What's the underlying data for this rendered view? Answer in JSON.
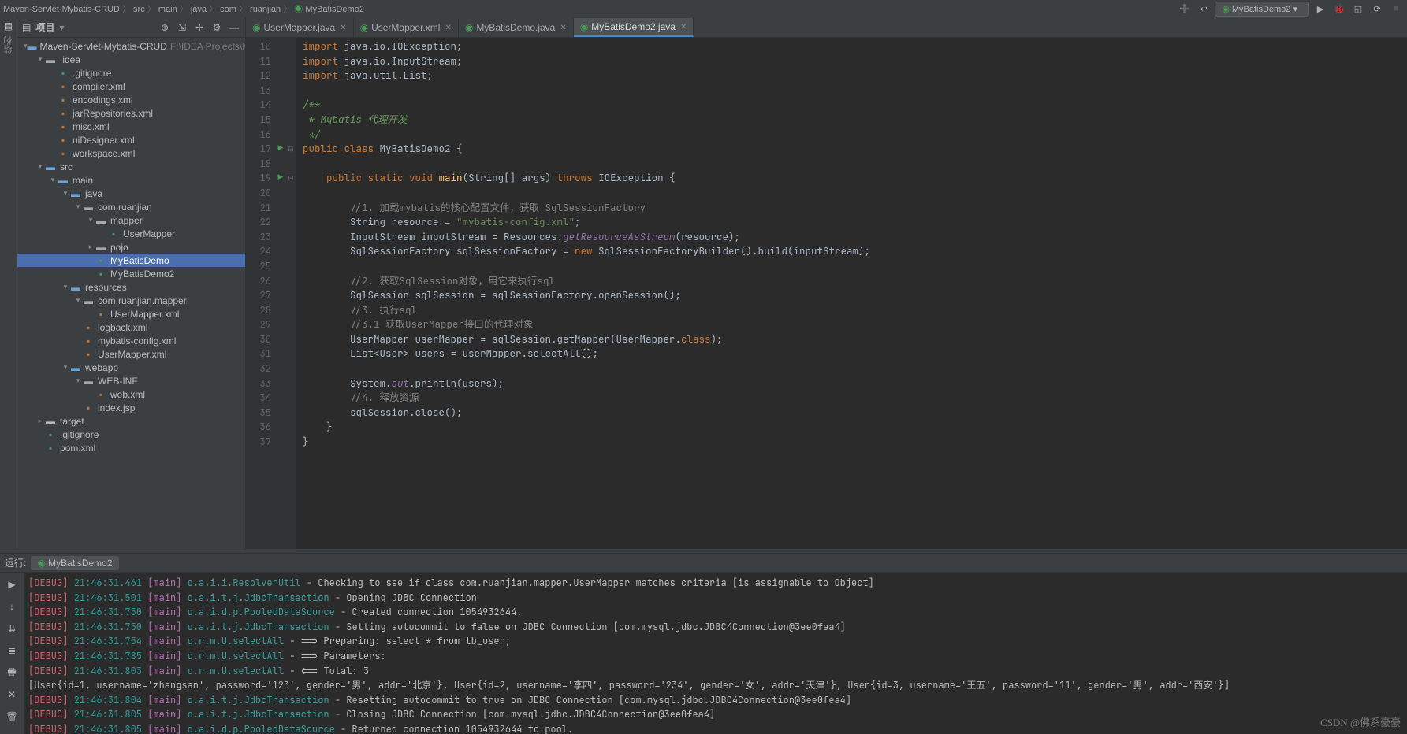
{
  "breadcrumb": [
    "Maven-Servlet-Mybatis-CRUD",
    "src",
    "main",
    "java",
    "com",
    "ruanjian",
    "MyBatisDemo2"
  ],
  "runConfig": "MyBatisDemo2",
  "projectPanel": {
    "title": "项目",
    "rootHint": "F:\\IDEA Projects\\M"
  },
  "tree": [
    {
      "d": 0,
      "a": "v",
      "i": "fold-blue",
      "t": "Maven-Servlet-Mybatis-CRUD",
      "hint": "F:\\IDEA Projects\\M"
    },
    {
      "d": 1,
      "a": "v",
      "i": "fold-open",
      "t": ".idea"
    },
    {
      "d": 2,
      "i": "file-teal",
      "t": ".gitignore"
    },
    {
      "d": 2,
      "i": "file-orange",
      "t": "compiler.xml"
    },
    {
      "d": 2,
      "i": "file-orange",
      "t": "encodings.xml"
    },
    {
      "d": 2,
      "i": "file-orange",
      "t": "jarRepositories.xml"
    },
    {
      "d": 2,
      "i": "file-orange",
      "t": "misc.xml"
    },
    {
      "d": 2,
      "i": "file-orange",
      "t": "uiDesigner.xml"
    },
    {
      "d": 2,
      "i": "file-orange",
      "t": "workspace.xml"
    },
    {
      "d": 1,
      "a": "v",
      "i": "fold-blue",
      "t": "src"
    },
    {
      "d": 2,
      "a": "v",
      "i": "fold-blue",
      "t": "main"
    },
    {
      "d": 3,
      "a": "v",
      "i": "fold-blue",
      "t": "java"
    },
    {
      "d": 4,
      "a": "v",
      "i": "fold-open",
      "t": "com.ruanjian"
    },
    {
      "d": 5,
      "a": "v",
      "i": "fold-open",
      "t": "mapper"
    },
    {
      "d": 6,
      "i": "file-teal",
      "t": "UserMapper"
    },
    {
      "d": 5,
      "a": ">",
      "i": "fold-open",
      "t": "pojo"
    },
    {
      "d": 5,
      "i": "file-green",
      "t": "MyBatisDemo",
      "sel": true
    },
    {
      "d": 5,
      "i": "file-green",
      "t": "MyBatisDemo2"
    },
    {
      "d": 3,
      "a": "v",
      "i": "fold-blue",
      "t": "resources"
    },
    {
      "d": 4,
      "a": "v",
      "i": "fold-open",
      "t": "com.ruanjian.mapper"
    },
    {
      "d": 5,
      "i": "file-orange",
      "t": "UserMapper.xml"
    },
    {
      "d": 4,
      "i": "file-orange",
      "t": "logback.xml"
    },
    {
      "d": 4,
      "i": "file-orange",
      "t": "mybatis-config.xml"
    },
    {
      "d": 4,
      "i": "file-orange",
      "t": "UserMapper.xml"
    },
    {
      "d": 3,
      "a": "v",
      "i": "fold-blue",
      "t": "webapp"
    },
    {
      "d": 4,
      "a": "v",
      "i": "fold-open",
      "t": "WEB-INF"
    },
    {
      "d": 5,
      "i": "file-orange",
      "t": "web.xml"
    },
    {
      "d": 4,
      "i": "file-orange",
      "t": "index.jsp"
    },
    {
      "d": 1,
      "a": ">",
      "i": "fold-orange",
      "t": "target"
    },
    {
      "d": 1,
      "i": "file-teal",
      "t": ".gitignore"
    },
    {
      "d": 1,
      "i": "file-teal",
      "t": "pom.xml"
    }
  ],
  "tabs": [
    {
      "icon": "interface",
      "label": "UserMapper.java"
    },
    {
      "icon": "xml",
      "label": "UserMapper.xml"
    },
    {
      "icon": "class",
      "label": "MyBatisDemo.java"
    },
    {
      "icon": "class",
      "label": "MyBatisDemo2.java",
      "active": true
    }
  ],
  "code": {
    "start": 10,
    "lines": [
      "<kw>import</kw> java.io.IOException;",
      "<kw>import</kw> java.io.InputStream;",
      "<kw>import</kw> java.util.List;",
      "",
      "<doccmt>/**</doccmt>",
      "<doccmt> * Mybatis 代理开发</doccmt>",
      "<doccmt> */</doccmt>",
      "<kw>public class</kw> MyBatisDemo2 {",
      "",
      "    <kw>public static void</kw> <fname>main</fname>(String[] args) <kw>throws</kw> IOException {",
      "",
      "        <cmt>//1. 加载mybatis的核心配置文件，获取 SqlSessionFactory</cmt>",
      "        String resource = <str>\"mybatis-config.xml\"</str>;",
      "        InputStream inputStream = Resources.<stat>getResourceAsStream</stat>(resource);",
      "        SqlSessionFactory sqlSessionFactory = <kw>new</kw> SqlSessionFactoryBuilder().build(inputStream);",
      "",
      "        <cmt>//2. 获取SqlSession对象，用它来执行sql</cmt>",
      "        SqlSession sqlSession = sqlSessionFactory.openSession();",
      "        <cmt>//3. 执行sql</cmt>",
      "        <cmt>//3.1 获取UserMapper接口的代理对象</cmt>",
      "        UserMapper userMapper = sqlSession.getMapper(UserMapper.<kw>class</kw>);",
      "        List&lt;User&gt; users = userMapper.selectAll();",
      "",
      "        System.<stat>out</stat>.println(users);",
      "        <cmt>//4. 释放资源</cmt>",
      "        sqlSession.close();",
      "    }",
      "}"
    ],
    "runMarkers": [
      17,
      19
    ]
  },
  "runTab": {
    "label": "运行:",
    "config": "MyBatisDemo2"
  },
  "console": [
    "<red>[DEBUG]</red> <cyan>21:46:31.461</cyan> <pur>[main]</pur> <teal>o.a.i.i.ResolverUtil</teal> - Checking to see if class com.ruanjian.mapper.UserMapper matches criteria [is assignable to Object]",
    "<red>[DEBUG]</red> <cyan>21:46:31.501</cyan> <pur>[main]</pur> <teal>o.a.i.t.j.JdbcTransaction</teal> - Opening JDBC Connection",
    "<red>[DEBUG]</red> <cyan>21:46:31.750</cyan> <pur>[main]</pur> <teal>o.a.i.d.p.PooledDataSource</teal> - Created connection 1054932644.",
    "<red>[DEBUG]</red> <cyan>21:46:31.750</cyan> <pur>[main]</pur> <teal>o.a.i.t.j.JdbcTransaction</teal> - Setting autocommit to false on JDBC Connection [com.mysql.jdbc.JDBC4Connection@3ee0fea4]",
    "<red>[DEBUG]</red> <cyan>21:46:31.754</cyan> <pur>[main]</pur> <teal>c.r.m.U.selectAll</teal> - ==&gt;  Preparing: select * from tb_user;",
    "<red>[DEBUG]</red> <cyan>21:46:31.785</cyan> <pur>[main]</pur> <teal>c.r.m.U.selectAll</teal> - ==&gt; Parameters:",
    "<red>[DEBUG]</red> <cyan>21:46:31.803</cyan> <pur>[main]</pur> <teal>c.r.m.U.selectAll</teal> - &lt;==      Total: 3",
    "[User{id=1, username='zhangsan', password='123', gender='男', addr='北京'}, User{id=2, username='李四', password='234', gender='女', addr='天津'}, User{id=3, username='王五', password='11', gender='男', addr='西安'}]",
    "<red>[DEBUG]</red> <cyan>21:46:31.804</cyan> <pur>[main]</pur> <teal>o.a.i.t.j.JdbcTransaction</teal> - Resetting autocommit to true on JDBC Connection [com.mysql.jdbc.JDBC4Connection@3ee0fea4]",
    "<red>[DEBUG]</red> <cyan>21:46:31.805</cyan> <pur>[main]</pur> <teal>o.a.i.t.j.JdbcTransaction</teal> - Closing JDBC Connection [com.mysql.jdbc.JDBC4Connection@3ee0fea4]",
    "<red>[DEBUG]</red> <cyan>21:46:31.805</cyan> <pur>[main]</pur> <teal>o.a.i.d.p.PooledDataSource</teal> - Returned connection 1054932644 to pool."
  ],
  "watermark": "CSDN @佛系豪豪"
}
